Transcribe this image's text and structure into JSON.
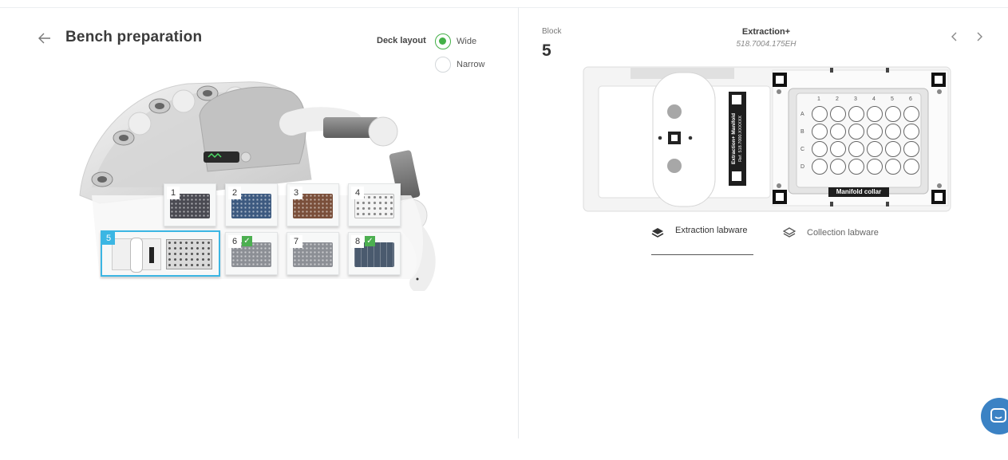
{
  "header": {
    "back_icon": "arrow-left-icon",
    "title": "Bench preparation"
  },
  "deck_layout": {
    "label": "Deck layout",
    "options": [
      {
        "label": "Wide",
        "selected": true
      },
      {
        "label": "Narrow",
        "selected": false
      }
    ],
    "accent_color": "#43b047"
  },
  "deck": {
    "slots": [
      {
        "label": "1",
        "checked": false,
        "plate_color": "#4a4a52"
      },
      {
        "label": "2",
        "checked": false,
        "plate_color": "#3d5a80"
      },
      {
        "label": "3",
        "checked": false,
        "plate_color": "#7a4f3a"
      },
      {
        "label": "4",
        "checked": false,
        "plate_color": "#f2f2f2"
      },
      {
        "label": "5",
        "checked": false,
        "plate_color": "#f2f2f2",
        "active": true
      },
      {
        "label": "6",
        "checked": true,
        "plate_color": "#8c8f95"
      },
      {
        "label": "7",
        "checked": false,
        "plate_color": "#8c8f95"
      },
      {
        "label": "8",
        "checked": true,
        "plate_color": "#4a5a6e"
      }
    ],
    "active_color": "#3bb6e3",
    "check_color": "#4caf50"
  },
  "block": {
    "label": "Block",
    "number": "5",
    "name": "Extraction+",
    "code": "518.7004.175EH",
    "prev_icon": "chevron-left-icon",
    "next_icon": "chevron-right-icon",
    "image": {
      "side_label_1": "Extraction+ Manifold",
      "side_label_2": "Ref. 518.7000.XXXXXX",
      "collar_label": "Manifold collar",
      "columns": [
        "1",
        "2",
        "3",
        "4",
        "5",
        "6"
      ],
      "rows": [
        "A",
        "B",
        "C",
        "D"
      ]
    }
  },
  "tabs": [
    {
      "label": "Extraction labware",
      "icon": "layers-filled-icon",
      "selected": true
    },
    {
      "label": "Collection labware",
      "icon": "layers-outline-icon",
      "selected": false
    }
  ],
  "chat": {
    "icon": "chat-bubble-icon",
    "color": "#3b82c4"
  }
}
